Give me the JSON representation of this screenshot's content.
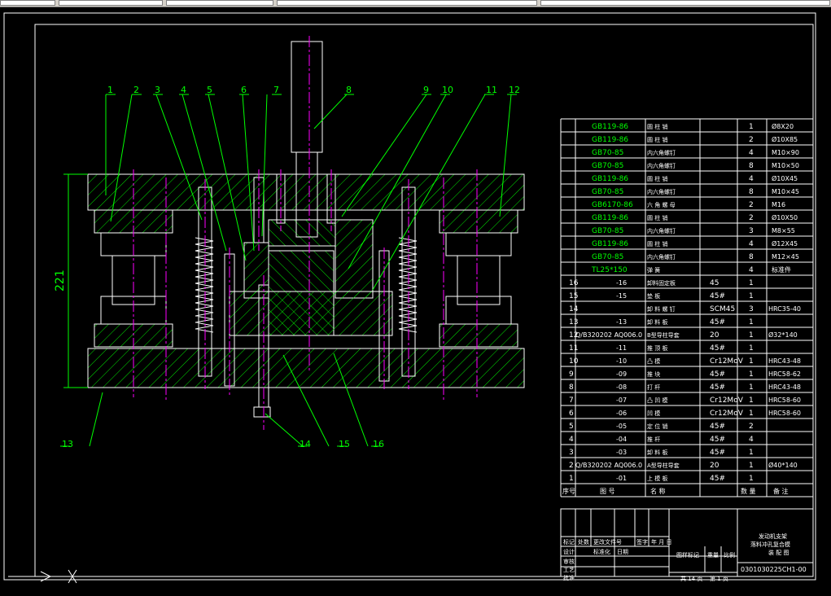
{
  "part_labels": [
    "1",
    "2",
    "3",
    "4",
    "5",
    "6",
    "7",
    "8",
    "9",
    "10",
    "11",
    "12",
    "13",
    "14",
    "15",
    "16"
  ],
  "dimension": "221",
  "standard_parts": [
    {
      "std": "GB119-86",
      "name": "圆 柱 销",
      "qty": "1",
      "spec": "Ø8X20"
    },
    {
      "std": "GB119-86",
      "name": "圆 柱 销",
      "qty": "2",
      "spec": "Ø10X85"
    },
    {
      "std": "GB70-85",
      "name": "内六角螺钉",
      "qty": "4",
      "spec": "M10×90"
    },
    {
      "std": "GB70-85",
      "name": "内六角螺钉",
      "qty": "8",
      "spec": "M10×50"
    },
    {
      "std": "GB119-86",
      "name": "圆 柱 销",
      "qty": "4",
      "spec": "Ø10X45"
    },
    {
      "std": "GB70-85",
      "name": "内六角螺钉",
      "qty": "8",
      "spec": "M10×45"
    },
    {
      "std": "GB6170-86",
      "name": "六 角 螺 母",
      "qty": "2",
      "spec": "M16"
    },
    {
      "std": "GB119-86",
      "name": "圆 柱 销",
      "qty": "2",
      "spec": "Ø10X50"
    },
    {
      "std": "GB70-85",
      "name": "内六角螺钉",
      "qty": "3",
      "spec": "M8×55"
    },
    {
      "std": "GB119-86",
      "name": "圆 柱 销",
      "qty": "4",
      "spec": "Ø12X45"
    },
    {
      "std": "GB70-85",
      "name": "内六角螺钉",
      "qty": "8",
      "spec": "M12×45"
    },
    {
      "std": "TL25*150",
      "name": "弹 簧",
      "qty": "4",
      "spec": "标准件"
    }
  ],
  "numbered_parts": [
    {
      "no": "16",
      "code": "-16",
      "name": "卸料固定板",
      "mat": "45",
      "qty": "1",
      "note": ""
    },
    {
      "no": "15",
      "code": "-15",
      "name": "垫 板",
      "mat": "45#",
      "qty": "1",
      "note": ""
    },
    {
      "no": "14",
      "code": "",
      "name": "卸 料 螺 钉",
      "mat": "SCM45",
      "qty": "3",
      "note": "HRC35-40"
    },
    {
      "no": "13",
      "code": "-13",
      "name": "卸 料 板",
      "mat": "45#",
      "qty": "1",
      "note": ""
    },
    {
      "no": "12",
      "code": "Q/B320202 AQ006.0",
      "name": "B型导柱导套",
      "mat": "20",
      "qty": "1",
      "note": "Ø32*140"
    },
    {
      "no": "11",
      "code": "-11",
      "name": "推 顶 板",
      "mat": "45#",
      "qty": "1",
      "note": ""
    },
    {
      "no": "10",
      "code": "-10",
      "name": "凸 模",
      "mat": "Cr12MoV",
      "qty": "1",
      "note": "HRC43-48"
    },
    {
      "no": "9",
      "code": "-09",
      "name": "推 块",
      "mat": "45#",
      "qty": "1",
      "note": "HRC58-62"
    },
    {
      "no": "8",
      "code": "-08",
      "name": "打 杆",
      "mat": "45#",
      "qty": "1",
      "note": "HRC43-48"
    },
    {
      "no": "7",
      "code": "-07",
      "name": "凸 凹 模",
      "mat": "Cr12MoV",
      "qty": "1",
      "note": "HRC58-60"
    },
    {
      "no": "6",
      "code": "-06",
      "name": "凹 模",
      "mat": "Cr12MoV",
      "qty": "1",
      "note": "HRC58-60"
    },
    {
      "no": "5",
      "code": "-05",
      "name": "定 位 销",
      "mat": "45#",
      "qty": "2",
      "note": ""
    },
    {
      "no": "4",
      "code": "-04",
      "name": "推 杆",
      "mat": "45#",
      "qty": "4",
      "note": ""
    },
    {
      "no": "3",
      "code": "-03",
      "name": "卸 料 板",
      "mat": "45#",
      "qty": "1",
      "note": ""
    },
    {
      "no": "2",
      "code": "Q/B320202 AQ006.0",
      "name": "A型导柱导套",
      "mat": "20",
      "qty": "1",
      "note": "Ø40*140"
    },
    {
      "no": "1",
      "code": "-01",
      "name": "上 模 板",
      "mat": "45#",
      "qty": "1",
      "note": ""
    }
  ],
  "bom_header": {
    "no": "序号",
    "code": "图 号",
    "name": "名 称",
    "qty": "数 量",
    "note": "备 注"
  },
  "title_block": {
    "title_line1": "发动机支架",
    "title_line2": "落料冲孔复合模",
    "title_line3": "装 配 图",
    "drawing_no": "0301030225CH1-00",
    "rev_labels": [
      "标记",
      "处数",
      "更改文件号",
      "签字",
      "年 月 日"
    ],
    "sign_labels": [
      "设计",
      "审核",
      "工艺",
      "批准"
    ],
    "standardization": "标准化",
    "date": "日期",
    "stage": "图样标记",
    "weight": "重量",
    "scale": "比例",
    "sheets": "共 14 页",
    "sheet": "第 1 页"
  },
  "colors": {
    "green": "#00ff00",
    "white": "#ffffff",
    "magenta": "#ff00ff",
    "bg": "#000000"
  }
}
